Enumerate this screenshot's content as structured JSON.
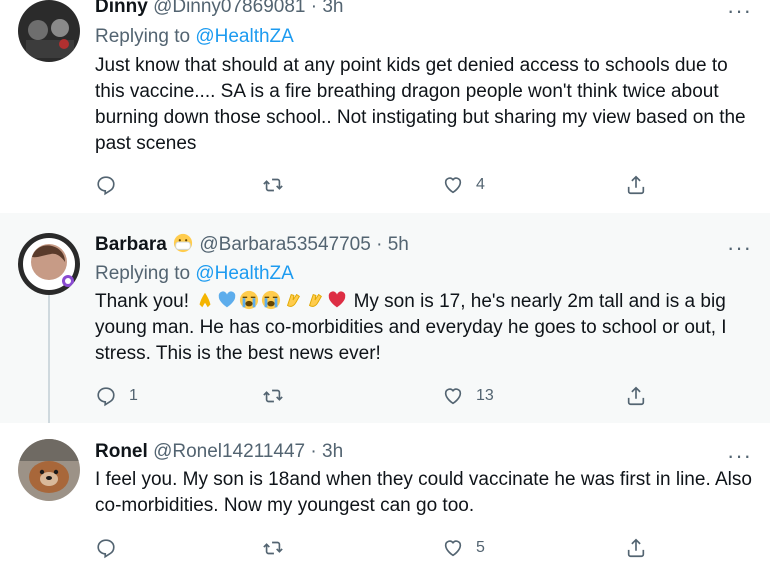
{
  "tweets": [
    {
      "name": "Dinny",
      "handle": "@Dinny07869081",
      "time": "3h",
      "replying_prefix": "Replying to",
      "replying_to": "@HealthZA",
      "text": "Just know that should at any point kids get denied access to schools due to this vaccine.... SA is a fire breathing dragon people won't think twice about burning down those school.. Not instigating but sharing my view based on the past scenes",
      "replies": "",
      "retweets": "",
      "likes": "4"
    },
    {
      "name": "Barbara",
      "name_emoji": "face-with-medical-mask",
      "handle": "@Barbara53547705",
      "time": "5h",
      "replying_prefix": "Replying to",
      "replying_to": "@HealthZA",
      "text_start": "Thank you!",
      "text_emojis": [
        "folded-hands",
        "blue-heart",
        "crying-face",
        "crying-face",
        "clapping-hands",
        "clapping-hands",
        "red-heart"
      ],
      "text_rest": "My son is 17, he's nearly 2m tall and is a big young man. He has co-morbidities and everyday he goes to school or out, I stress. This is the best news ever!",
      "replies": "1",
      "retweets": "",
      "likes": "13"
    },
    {
      "name": "Ronel",
      "handle": "@Ronel14211447",
      "time": "3h",
      "text": "I feel you. My son is 18and when they could vaccinate he was first in line. Also co-morbidities.  Now my youngest can go too.",
      "replies": "",
      "retweets": "",
      "likes": "5"
    }
  ],
  "sep": "·",
  "more": "···"
}
